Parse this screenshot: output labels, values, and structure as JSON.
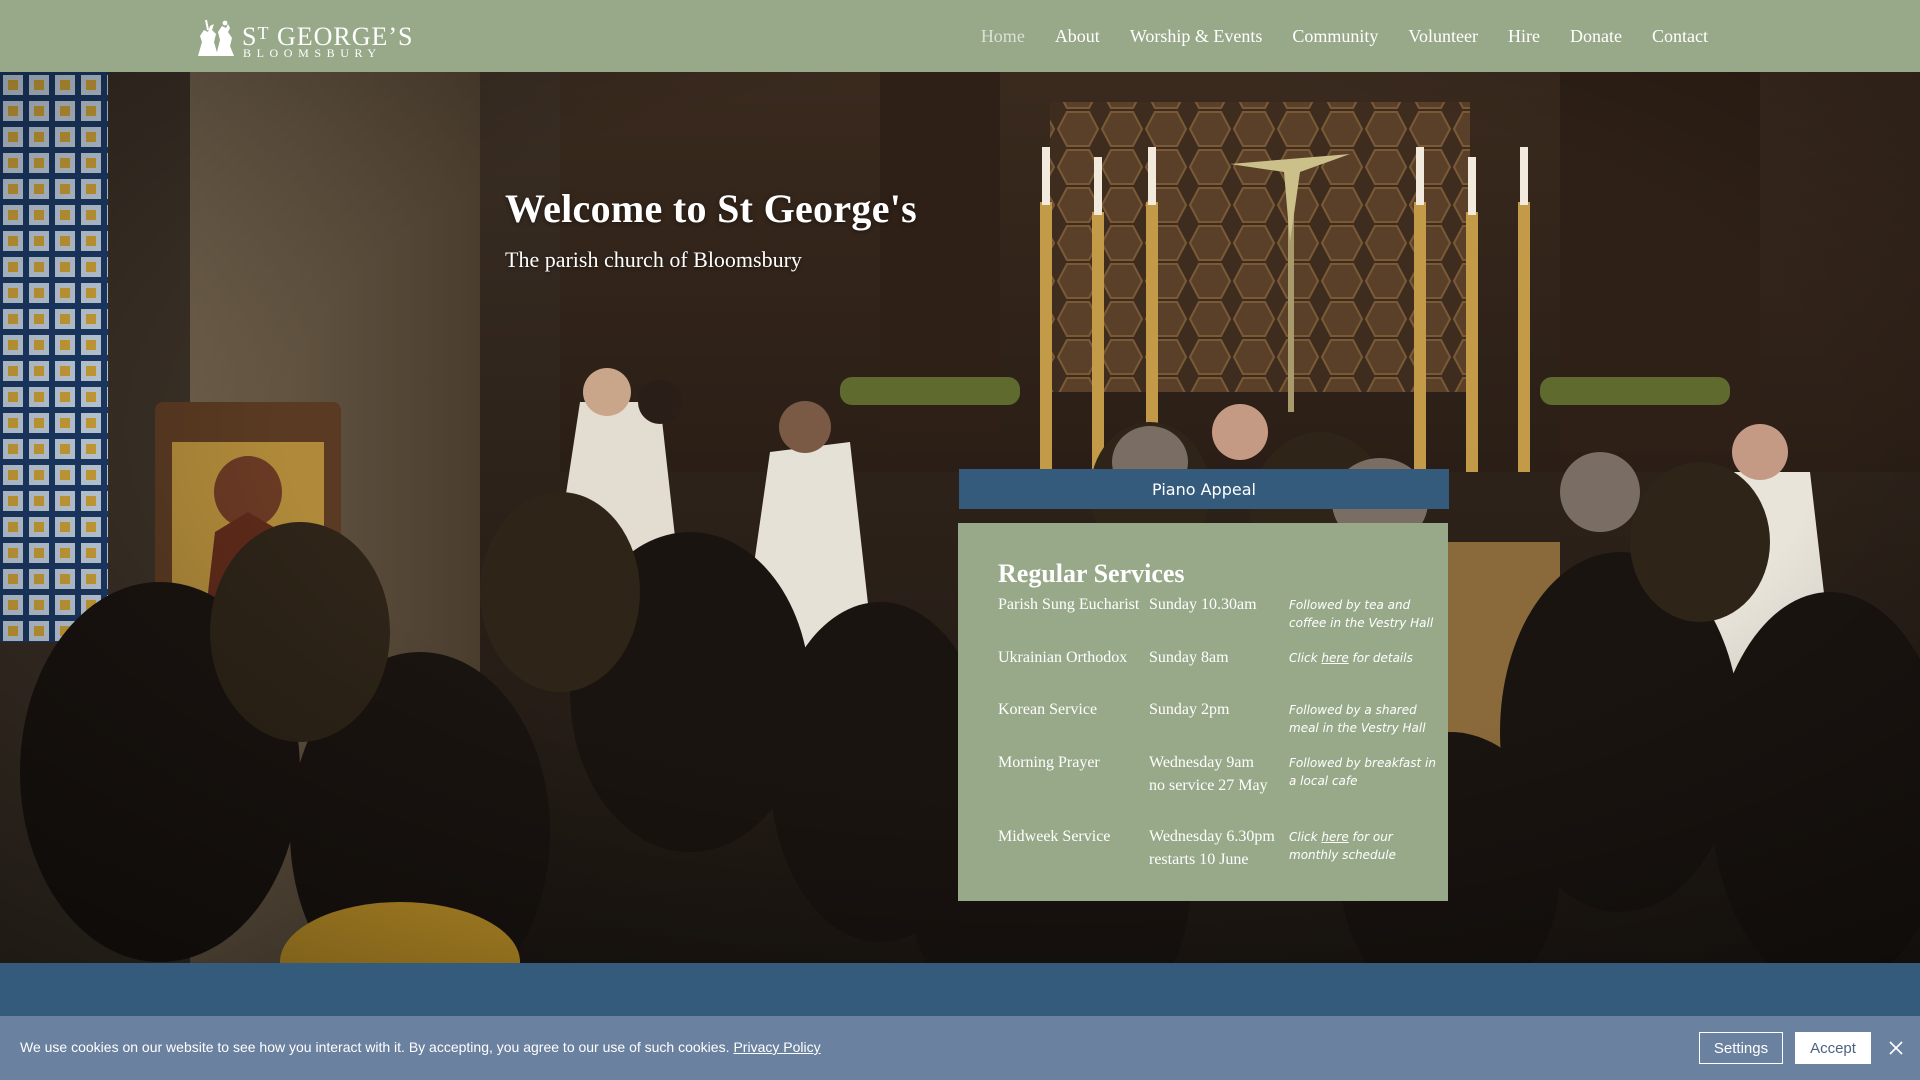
{
  "header": {
    "logo": {
      "line1_main": "S",
      "line1_sup": "T",
      "line1_rest": " GEORGE’S",
      "line2": "BLOOMSBURY"
    },
    "nav": [
      {
        "label": "Home",
        "active": true
      },
      {
        "label": "About"
      },
      {
        "label": "Worship & Events"
      },
      {
        "label": "Community"
      },
      {
        "label": "Volunteer"
      },
      {
        "label": "Hire"
      },
      {
        "label": "Donate"
      },
      {
        "label": "Contact"
      }
    ]
  },
  "hero": {
    "title": "Welcome to St George's",
    "subtitle": "The parish church of Bloomsbury",
    "appeal_label": "Piano Appeal"
  },
  "services": {
    "title": "Regular Services",
    "rows": [
      {
        "name": "Parish Sung Eucharist",
        "time1": "Sunday 10.30am",
        "time2": "",
        "note_pre": "Followed by tea and coffee in the Vestry Hall",
        "note_link": "",
        "note_post": ""
      },
      {
        "name": "Ukrainian Orthodox",
        "time1": "Sunday 8am",
        "time2": "",
        "note_pre": "Click ",
        "note_link": "here",
        "note_post": " for details"
      },
      {
        "name": "Korean Service",
        "time1": "Sunday 2pm",
        "time2": "",
        "note_pre": "Followed by a shared meal in the Vestry Hall",
        "note_link": "",
        "note_post": ""
      },
      {
        "name": "Morning Prayer",
        "time1": "Wednesday 9am",
        "time2": "no service 27 May",
        "note_pre": "Followed by breakfast in a local cafe",
        "note_link": "",
        "note_post": ""
      },
      {
        "name": "Midweek Service",
        "time1": "Wednesday 6.30pm",
        "time2": "restarts 10 June",
        "note_pre": "Click ",
        "note_link": "here",
        "note_post": " for our monthly schedule"
      }
    ]
  },
  "cookie": {
    "text": "We use cookies on our website to see how you interact with it. By accepting, you agree to our use of such cookies.",
    "privacy_link": "Privacy Policy",
    "settings_label": "Settings",
    "accept_label": "Accept"
  },
  "colors": {
    "header_green": "#98a98a",
    "appeal_blue": "#345a7c",
    "card_green": "#98a98a",
    "cookie_bar": "#6a81a0"
  },
  "icons": {
    "logo": "saint-george-dragon-icon",
    "close": "close-icon"
  }
}
